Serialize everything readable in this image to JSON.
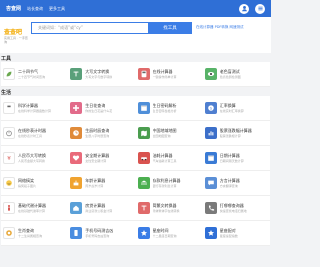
{
  "topbar": {
    "brand": "杏查网",
    "nav": [
      "站长查询",
      "更多工具"
    ]
  },
  "header": {
    "logo_main": "查查吧",
    "logo_sub": "实用工具 · 一手查询",
    "search_placeholder": "关键词如：“成语”或“cy”",
    "search_button": "找工具",
    "hot_links": "在线计算器  PDF转换  网速测试"
  },
  "sections": [
    {
      "title": "工具",
      "rows": [
        [
          {
            "title": "二十四节气",
            "desc": "二十四节气时间查询",
            "icon": "leaf-icon",
            "color": "#ffffff"
          },
          {
            "title": "大写文字转换",
            "desc": "大写文字与数字转换",
            "icon": "text-icon",
            "color": "#5aa07a"
          },
          {
            "title": "在线计算器",
            "desc": "一键操作简单计算",
            "icon": "calculator-icon",
            "color": "#e06a6a"
          },
          {
            "title": "老色盲测试",
            "desc": "色盲色弱检测图",
            "icon": "eye-icon",
            "color": "#58b368"
          }
        ]
      ]
    },
    {
      "title": "生活",
      "rows": [
        [
          {
            "title": "科学计算器",
            "desc": "在线科学计算器函数计算",
            "icon": "calculator-icon",
            "color": "#ffffff"
          },
          {
            "title": "生日花查询",
            "desc": "你的生日花是什么花",
            "icon": "flower-icon",
            "color": "#e26b8a"
          },
          {
            "title": "生日密码解析",
            "desc": "生日密码性格分析",
            "icon": "calendar-icon",
            "color": "#4f8fd9"
          },
          {
            "title": "汇率换算",
            "desc": "在线实时汇率换算",
            "icon": "currency-icon",
            "color": "#4f7fd0"
          }
        ],
        [
          {
            "title": "在线秒表计时器",
            "desc": "在线秒表计时工具",
            "icon": "timer-icon",
            "color": "#ffffff"
          },
          {
            "title": "生辰时辰查询",
            "desc": "生辰八字时辰查询",
            "icon": "clock-icon",
            "color": "#e08b3a"
          },
          {
            "title": "中国地域地图",
            "desc": "全国地图查询",
            "icon": "map-icon",
            "color": "#4b9d4f"
          },
          {
            "title": "股票涨跌幅计算器",
            "desc": "股票涨跌幅计算",
            "icon": "chart-icon",
            "color": "#3c6fc9"
          }
        ],
        [
          {
            "title": "人民币大写转换",
            "desc": "人民币金额大写转换",
            "icon": "yuan-icon",
            "color": "#ffffff"
          },
          {
            "title": "安全期计算器",
            "desc": "女性安全期计算",
            "icon": "heart-icon",
            "color": "#e96a7a"
          },
          {
            "title": "油耗计算器",
            "desc": "汽车油耗计算工具",
            "icon": "car-icon",
            "color": "#d9534f"
          },
          {
            "title": "日期计算器",
            "desc": "日期间隔天数计算",
            "icon": "calendar-icon",
            "color": "#3a7bd5"
          }
        ],
        [
          {
            "title": "网络搞笑",
            "desc": "搞笑段子图片",
            "icon": "smile-icon",
            "color": "#ffffff"
          },
          {
            "title": "年龄计算器",
            "desc": "周岁虚岁计算",
            "icon": "cake-icon",
            "color": "#f0a330"
          },
          {
            "title": "存款利息计算器",
            "desc": "银行存款利息计算",
            "icon": "bank-icon",
            "color": "#4caf50"
          },
          {
            "title": "方言计算器",
            "desc": "方言翻译查询",
            "icon": "speech-icon",
            "color": "#5b8fd6"
          }
        ],
        [
          {
            "title": "基础代谢计算器",
            "desc": "在线基础代谢率计算",
            "icon": "body-icon",
            "color": "#ffffff"
          },
          {
            "title": "房贷计算器",
            "desc": "商业贷款公积金计算",
            "icon": "house-icon",
            "color": "#5aa0d8"
          },
          {
            "title": "简繁文转换器",
            "desc": "简体繁体字在线转换",
            "icon": "text-icon",
            "color": "#e06a6a"
          },
          {
            "title": "打哪哪查询器",
            "desc": "快速查找电话归属地",
            "icon": "phone-icon",
            "color": "#7a7a7a"
          }
        ],
        [
          {
            "title": "生肖查询",
            "desc": "十二生肖属相查询",
            "icon": "zodiac-icon",
            "color": "#ffffff"
          },
          {
            "title": "手机号码测吉凶",
            "desc": "手机号码吉凶查询",
            "icon": "mobile-icon",
            "color": "#4a8de0"
          },
          {
            "title": "星座时间",
            "desc": "十二星座日期查询",
            "icon": "star-icon",
            "color": "#3b7de6"
          },
          {
            "title": "星座配对",
            "desc": "星座速配指数",
            "icon": "star-icon",
            "color": "#2f6fd6"
          }
        ]
      ]
    }
  ]
}
